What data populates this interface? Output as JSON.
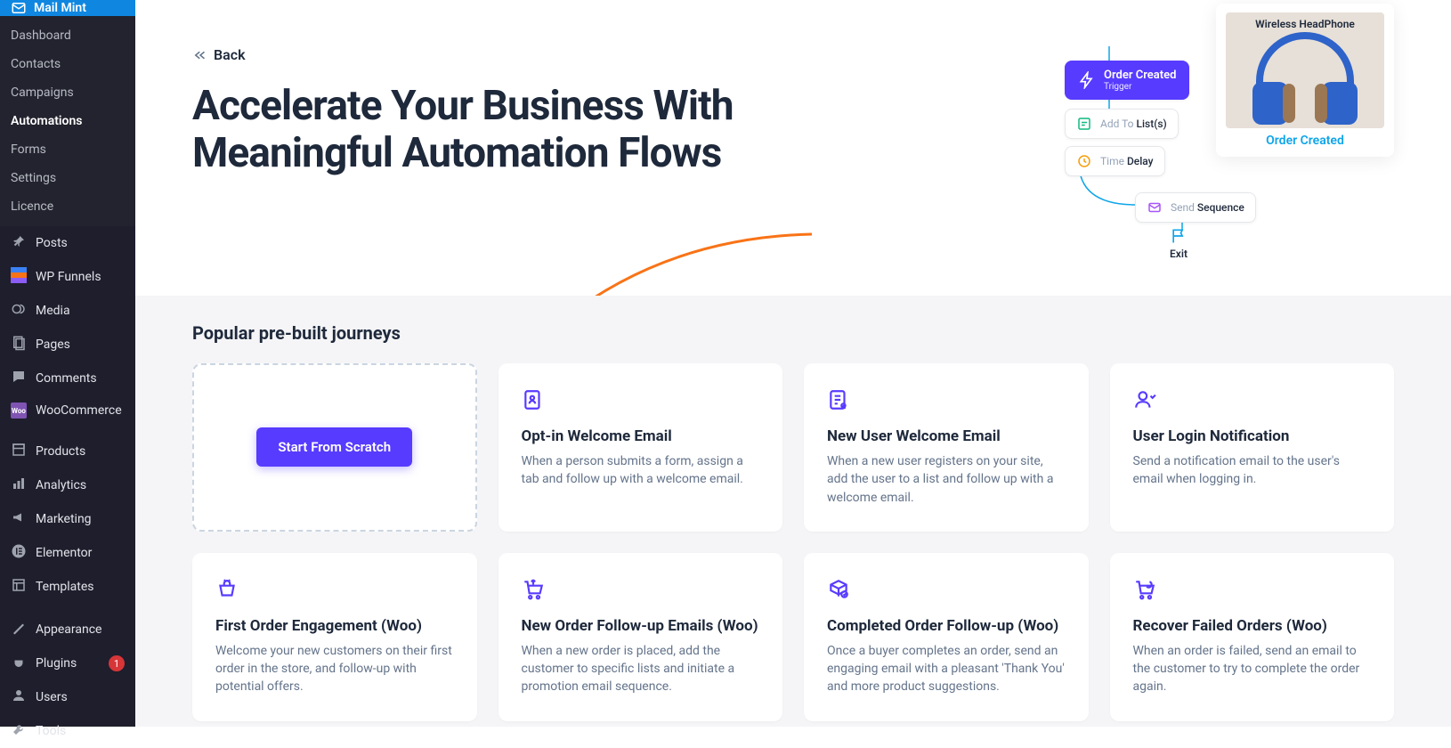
{
  "brand": "Mail Mint",
  "submenu": [
    "Dashboard",
    "Contacts",
    "Campaigns",
    "Automations",
    "Forms",
    "Settings",
    "Licence"
  ],
  "submenu_active": 3,
  "nav": [
    {
      "label": "Posts",
      "icon": "pin"
    },
    {
      "label": "WP Funnels",
      "icon": "wpfunnels"
    },
    {
      "label": "Media",
      "icon": "media"
    },
    {
      "label": "Pages",
      "icon": "pages"
    },
    {
      "label": "Comments",
      "icon": "comments"
    },
    {
      "label": "WooCommerce",
      "icon": "woo"
    },
    {
      "label": "Products",
      "icon": "products"
    },
    {
      "label": "Analytics",
      "icon": "analytics"
    },
    {
      "label": "Marketing",
      "icon": "marketing"
    },
    {
      "label": "Elementor",
      "icon": "elementor"
    },
    {
      "label": "Templates",
      "icon": "templates"
    },
    {
      "label": "Appearance",
      "icon": "appearance"
    },
    {
      "label": "Plugins",
      "icon": "plugins",
      "badge": "1"
    },
    {
      "label": "Users",
      "icon": "users"
    },
    {
      "label": "Tools",
      "icon": "tools"
    }
  ],
  "back": "Back",
  "title_line1": "Accelerate Your Business With",
  "title_line2": "Meaningful Automation Flows",
  "flow": {
    "trigger": {
      "label": "Order Created",
      "sub": "Trigger"
    },
    "list": {
      "prefix": "Add To",
      "bold": "List(s)"
    },
    "delay": {
      "prefix": "Time",
      "bold": "Delay"
    },
    "seq": {
      "prefix": "Send",
      "bold": "Sequence"
    },
    "exit": "Exit"
  },
  "product": {
    "name": "Wireless HeadPhone",
    "link": "Order Created"
  },
  "section_title": "Popular pre-built journeys",
  "scratch_label": "Start From Scratch",
  "cards": [
    {
      "title": "Opt-in Welcome Email",
      "desc": "When a person submits a form, assign a tab and follow up with a welcome email."
    },
    {
      "title": "New User Welcome Email",
      "desc": "When a new user registers on your site, add the user to a list and follow up with a welcome email."
    },
    {
      "title": "User Login Notification",
      "desc": "Send a notification email to the user's email when logging in."
    },
    {
      "title": "First Order Engagement (Woo)",
      "desc": "Welcome your new customers on their first order in the store, and follow-up with potential offers."
    },
    {
      "title": "New Order Follow-up Emails (Woo)",
      "desc": "When a new order is placed, add the customer to specific lists and initiate a promotion email sequence."
    },
    {
      "title": "Completed Order Follow-up (Woo)",
      "desc": "Once a buyer completes an order, send an engaging email with a pleasant 'Thank You' and more product suggestions."
    },
    {
      "title": "Recover Failed Orders (Woo)",
      "desc": "When an order is failed, send an email to the customer to try to complete the order again."
    }
  ]
}
